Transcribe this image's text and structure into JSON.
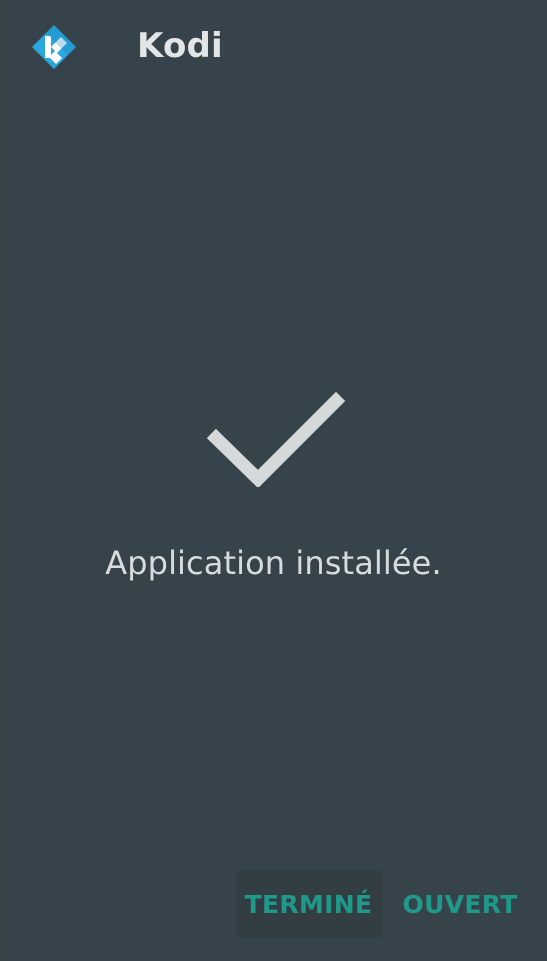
{
  "app": {
    "title": "Kodi",
    "logo_icon": "kodi-logo-icon"
  },
  "status": {
    "icon": "checkmark-icon",
    "message": "Application installée."
  },
  "actions": {
    "done_label": "TERMINÉ",
    "open_label": "OUVERT"
  },
  "colors": {
    "background": "#37434a",
    "accent": "#1f9a8a",
    "primary_text": "#e3e5e6",
    "logo_blue": "#2aa7dd"
  }
}
